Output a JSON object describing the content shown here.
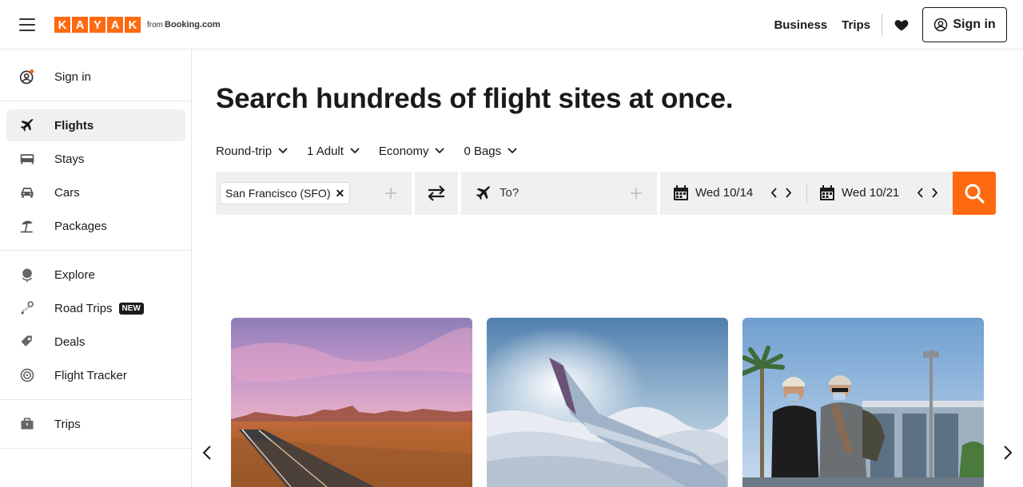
{
  "header": {
    "logo_letters": [
      "K",
      "A",
      "Y",
      "A",
      "K"
    ],
    "logo_from": "from",
    "logo_partner": "Booking.com",
    "nav": {
      "business": "Business",
      "trips": "Trips"
    },
    "sign_in": "Sign in"
  },
  "sidebar": {
    "sign_in": "Sign in",
    "items": [
      {
        "label": "Flights",
        "icon": "plane-icon"
      },
      {
        "label": "Stays",
        "icon": "bed-icon"
      },
      {
        "label": "Cars",
        "icon": "car-icon"
      },
      {
        "label": "Packages",
        "icon": "beach-umbrella-icon"
      },
      {
        "label": "Explore",
        "icon": "globe-icon"
      },
      {
        "label": "Road Trips",
        "icon": "route-icon",
        "badge": "NEW"
      },
      {
        "label": "Deals",
        "icon": "tag-icon"
      },
      {
        "label": "Flight Tracker",
        "icon": "radar-icon"
      },
      {
        "label": "Trips",
        "icon": "briefcase-icon"
      }
    ]
  },
  "main": {
    "title": "Search hundreds of flight sites at once.",
    "options": {
      "trip_type": "Round-trip",
      "travelers": "1 Adult",
      "cabin": "Economy",
      "bags": "0 Bags"
    },
    "search": {
      "origin": "San Francisco (SFO)",
      "destination_placeholder": "To?",
      "depart_date": "Wed 10/14",
      "return_date": "Wed 10/21"
    }
  },
  "colors": {
    "brand": "#ff690f",
    "field_bg": "#f0f0f2",
    "text": "#1a1a1a",
    "notification_dot": "#ff690f"
  }
}
